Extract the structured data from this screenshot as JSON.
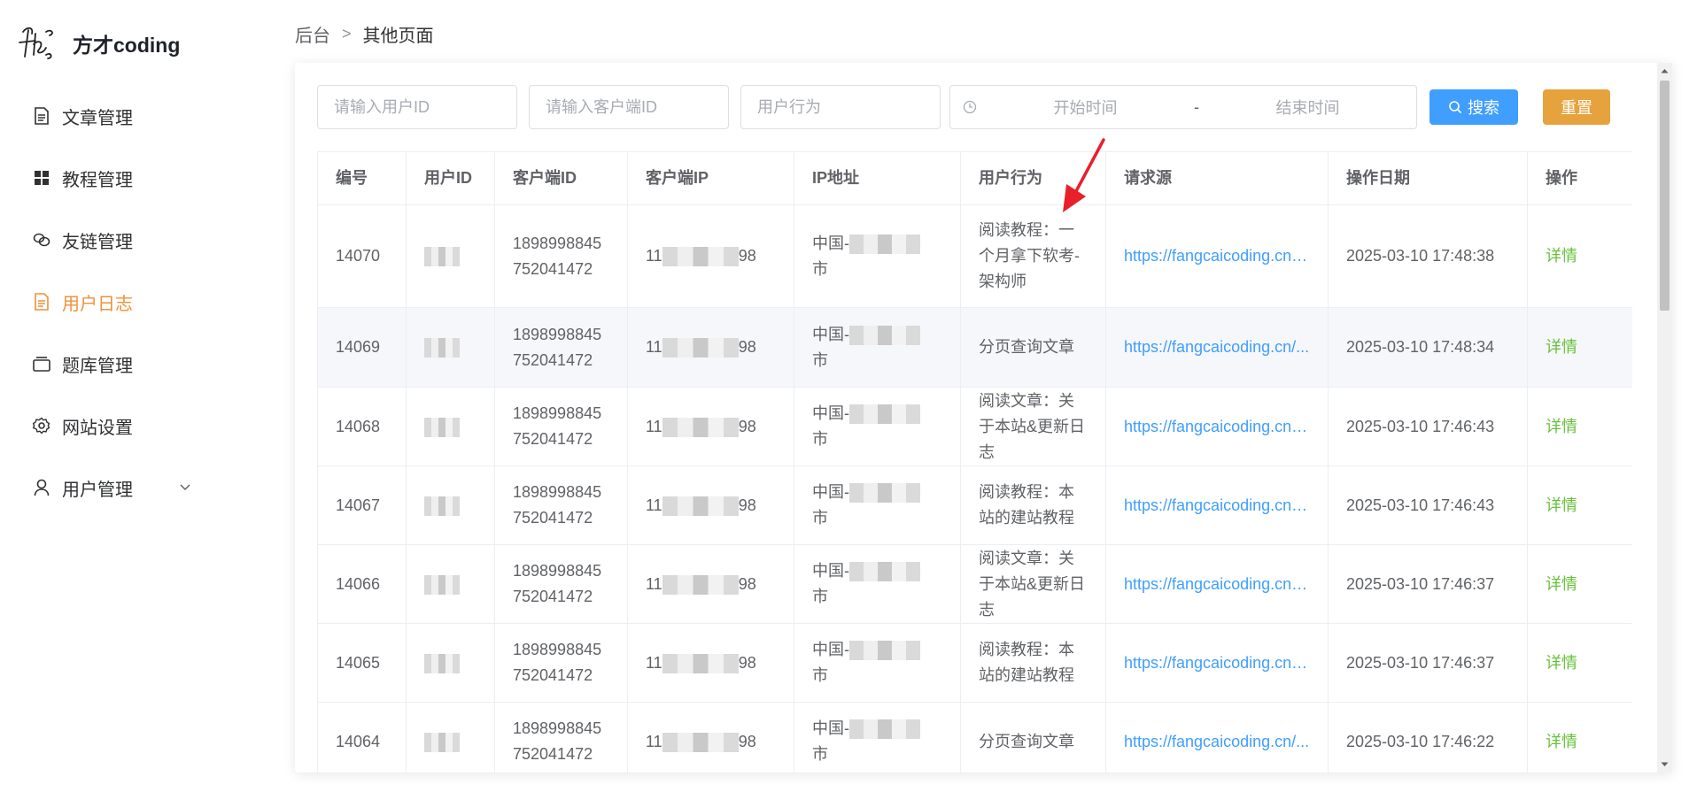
{
  "brand": {
    "name": "方才coding"
  },
  "sidebar": {
    "items": [
      {
        "label": "文章管理",
        "icon": "document-icon",
        "active": false
      },
      {
        "label": "教程管理",
        "icon": "grid-icon",
        "active": false
      },
      {
        "label": "友链管理",
        "icon": "link-icon",
        "active": false
      },
      {
        "label": "用户日志",
        "icon": "log-icon",
        "active": true
      },
      {
        "label": "题库管理",
        "icon": "box-icon",
        "active": false
      },
      {
        "label": "网站设置",
        "icon": "gear-icon",
        "active": false
      },
      {
        "label": "用户管理",
        "icon": "user-icon",
        "active": false,
        "expandable": true
      }
    ]
  },
  "breadcrumb": {
    "root": "后台",
    "separator": ">",
    "current": "其他页面"
  },
  "filters": {
    "user_id_placeholder": "请输入用户ID",
    "client_id_placeholder": "请输入客户端ID",
    "action_placeholder": "用户行为",
    "start_placeholder": "开始时间",
    "range_separator": "-",
    "end_placeholder": "结束时间"
  },
  "buttons": {
    "search": "搜索",
    "reset": "重置"
  },
  "colors": {
    "accent": "#409eff",
    "active_menu": "#f0913a",
    "reset": "#e6a23c",
    "operation": "#67c23a"
  },
  "table": {
    "headers": [
      "编号",
      "用户ID",
      "客户端ID",
      "客户端IP",
      "IP地址",
      "用户行为",
      "请求源",
      "操作日期",
      "操作"
    ],
    "rows": [
      {
        "id": "14070",
        "client_id": "1898998845752041472",
        "ip_prefix": "11",
        "ip_suffix": "98",
        "location_prefix": "中国-",
        "location_suffix": "市",
        "action": "阅读教程：一个月拿下软考-架构师",
        "source": "https://fangcaicoding.cn/cc",
        "date": "2025-03-10 17:48:38",
        "op": "详情"
      },
      {
        "id": "14069",
        "client_id": "1898998845752041472",
        "ip_prefix": "11",
        "ip_suffix": "98",
        "location_prefix": "中国-",
        "location_suffix": "市",
        "action": "分页查询文章",
        "source": "https://fangcaicoding.cn/...",
        "date": "2025-03-10 17:48:34",
        "op": "详情"
      },
      {
        "id": "14068",
        "client_id": "1898998845752041472",
        "ip_prefix": "11",
        "ip_suffix": "98",
        "location_prefix": "中国-",
        "location_suffix": "市",
        "action": "阅读文章：关于本站&更新日志",
        "source": "https://fangcaicoding.cn/cc",
        "date": "2025-03-10 17:46:43",
        "op": "详情"
      },
      {
        "id": "14067",
        "client_id": "1898998845752041472",
        "ip_prefix": "11",
        "ip_suffix": "98",
        "location_prefix": "中国-",
        "location_suffix": "市",
        "action": "阅读教程：本站的建站教程",
        "source": "https://fangcaicoding.cn/cc",
        "date": "2025-03-10 17:46:43",
        "op": "详情"
      },
      {
        "id": "14066",
        "client_id": "1898998845752041472",
        "ip_prefix": "11",
        "ip_suffix": "98",
        "location_prefix": "中国-",
        "location_suffix": "市",
        "action": "阅读文章：关于本站&更新日志",
        "source": "https://fangcaicoding.cn/cc",
        "date": "2025-03-10 17:46:37",
        "op": "详情"
      },
      {
        "id": "14065",
        "client_id": "1898998845752041472",
        "ip_prefix": "11",
        "ip_suffix": "98",
        "location_prefix": "中国-",
        "location_suffix": "市",
        "action": "阅读教程：本站的建站教程",
        "source": "https://fangcaicoding.cn/cc",
        "date": "2025-03-10 17:46:37",
        "op": "详情"
      },
      {
        "id": "14064",
        "client_id": "1898998845752041472",
        "ip_prefix": "11",
        "ip_suffix": "98",
        "location_prefix": "中国-",
        "location_suffix": "市",
        "action": "分页查询文章",
        "source": "https://fangcaicoding.cn/...",
        "date": "2025-03-10 17:46:22",
        "op": "详情"
      }
    ]
  }
}
